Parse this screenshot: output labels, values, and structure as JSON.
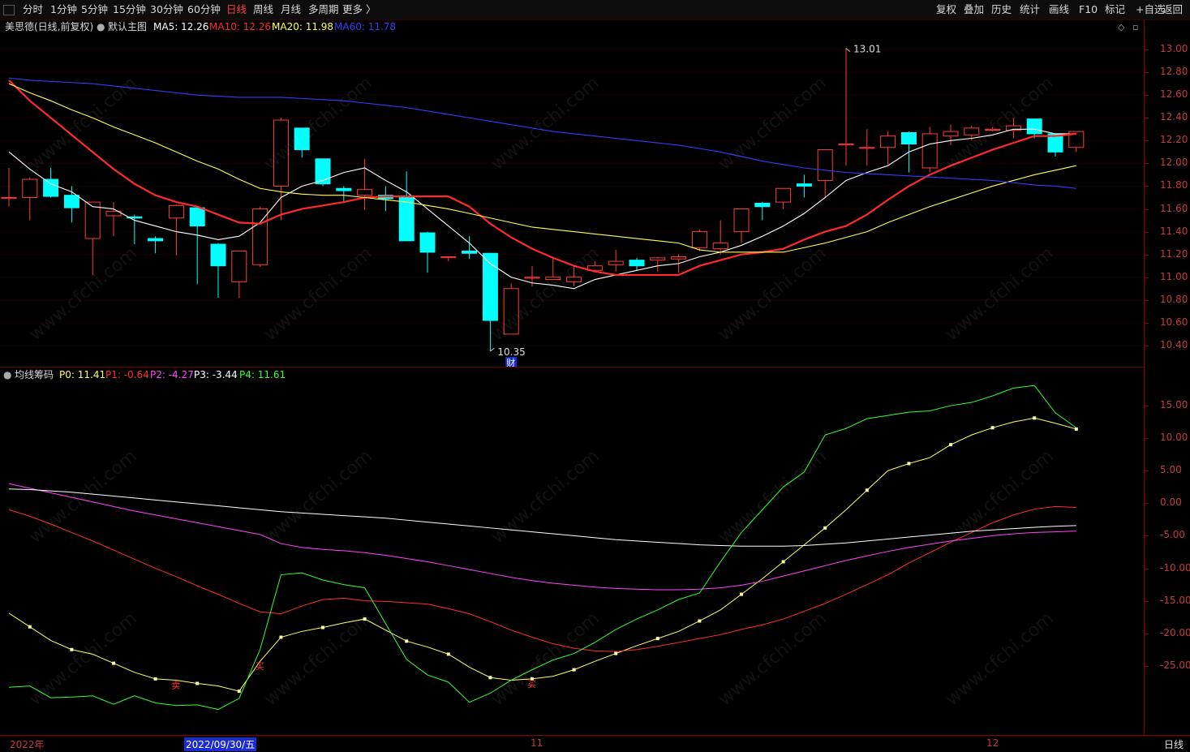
{
  "toolbar": {
    "left": [
      "分时",
      "1分钟",
      "5分钟",
      "15分钟",
      "30分钟",
      "60分钟",
      "日线",
      "周线",
      "月线",
      "多周期",
      "更多 〉"
    ],
    "active_index": 6,
    "right": [
      "复权",
      "叠加",
      "历史",
      "统计",
      "画线",
      "F10",
      "标记",
      "+自选",
      "返回"
    ]
  },
  "info": {
    "stock_title": "美思德(日线,前复权)",
    "main_chart": "默认主图",
    "ma": [
      {
        "label": "MA5: 12.26",
        "color": "#ffffff"
      },
      {
        "label": "MA10: 12.26",
        "color": "#ff2a2a"
      },
      {
        "label": "MA20: 11.98",
        "color": "#ffff55"
      },
      {
        "label": "MA60: 11.78",
        "color": "#3a3aff"
      }
    ]
  },
  "indicator": {
    "name": "均线筹码",
    "params": [
      {
        "label": "P0: 11.41",
        "color": "#ffff66"
      },
      {
        "label": "P1: -0.64",
        "color": "#ff3030"
      },
      {
        "label": "P2: -4.27",
        "color": "#ff44ff"
      },
      {
        "label": "P3: -3.44",
        "color": "#ffffff"
      },
      {
        "label": "P4: 11.61",
        "color": "#33ff33"
      }
    ]
  },
  "chart_data": [
    {
      "type": "candlestick",
      "ylim": [
        10.25,
        13.1
      ],
      "y_ticks": [
        "13.00",
        "12.80",
        "12.60",
        "12.40",
        "12.20",
        "12.00",
        "11.80",
        "11.60",
        "11.40",
        "11.20",
        "11.00",
        "10.80",
        "10.60",
        "10.40"
      ],
      "annotations": {
        "high_label": "13.01",
        "low_label": "10.35",
        "event_marker": "财"
      },
      "candles": [
        {
          "o": 11.7,
          "h": 11.96,
          "l": 11.62,
          "c": 11.7
        },
        {
          "o": 11.7,
          "h": 11.88,
          "l": 11.5,
          "c": 11.86
        },
        {
          "o": 11.86,
          "h": 11.96,
          "l": 11.7,
          "c": 11.71
        },
        {
          "o": 11.72,
          "h": 11.8,
          "l": 11.48,
          "c": 11.61
        },
        {
          "o": 11.34,
          "h": 11.66,
          "l": 11.02,
          "c": 11.66
        },
        {
          "o": 11.54,
          "h": 11.66,
          "l": 11.36,
          "c": 11.58
        },
        {
          "o": 11.53,
          "h": 11.55,
          "l": 11.29,
          "c": 11.52
        },
        {
          "o": 11.34,
          "h": 11.36,
          "l": 11.21,
          "c": 11.32
        },
        {
          "o": 11.52,
          "h": 11.64,
          "l": 11.19,
          "c": 11.63
        },
        {
          "o": 11.61,
          "h": 11.61,
          "l": 10.94,
          "c": 11.45
        },
        {
          "o": 11.29,
          "h": 11.3,
          "l": 10.82,
          "c": 11.1
        },
        {
          "o": 10.96,
          "h": 11.23,
          "l": 10.82,
          "c": 11.23
        },
        {
          "o": 11.11,
          "h": 11.62,
          "l": 11.09,
          "c": 11.6
        },
        {
          "o": 11.8,
          "h": 12.4,
          "l": 11.5,
          "c": 12.38
        },
        {
          "o": 12.31,
          "h": 12.31,
          "l": 12.05,
          "c": 12.12
        },
        {
          "o": 12.04,
          "h": 12.04,
          "l": 11.8,
          "c": 11.82
        },
        {
          "o": 11.78,
          "h": 11.8,
          "l": 11.65,
          "c": 11.76
        },
        {
          "o": 11.72,
          "h": 12.04,
          "l": 11.59,
          "c": 11.77
        },
        {
          "o": 11.72,
          "h": 11.8,
          "l": 11.58,
          "c": 11.69
        },
        {
          "o": 11.71,
          "h": 11.93,
          "l": 11.56,
          "c": 11.32
        },
        {
          "o": 11.39,
          "h": 11.4,
          "l": 11.04,
          "c": 11.22
        },
        {
          "o": 11.18,
          "h": 11.18,
          "l": 11.14,
          "c": 11.18
        },
        {
          "o": 11.23,
          "h": 11.36,
          "l": 11.16,
          "c": 11.21
        },
        {
          "o": 11.21,
          "h": 11.21,
          "l": 10.35,
          "c": 10.62
        },
        {
          "o": 10.5,
          "h": 10.95,
          "l": 10.5,
          "c": 10.9
        },
        {
          "o": 11.0,
          "h": 11.1,
          "l": 10.92,
          "c": 11.0
        },
        {
          "o": 10.98,
          "h": 11.18,
          "l": 10.98,
          "c": 11.0
        },
        {
          "o": 10.96,
          "h": 11.1,
          "l": 10.92,
          "c": 11.0
        },
        {
          "o": 11.06,
          "h": 11.14,
          "l": 11.05,
          "c": 11.1
        },
        {
          "o": 11.11,
          "h": 11.24,
          "l": 11.05,
          "c": 11.14
        },
        {
          "o": 11.15,
          "h": 11.17,
          "l": 11.06,
          "c": 11.1
        },
        {
          "o": 11.15,
          "h": 11.18,
          "l": 11.05,
          "c": 11.17
        },
        {
          "o": 11.16,
          "h": 11.2,
          "l": 11.04,
          "c": 11.18
        },
        {
          "o": 11.26,
          "h": 11.42,
          "l": 11.23,
          "c": 11.4
        },
        {
          "o": 11.25,
          "h": 11.5,
          "l": 11.2,
          "c": 11.3
        },
        {
          "o": 11.4,
          "h": 11.6,
          "l": 11.3,
          "c": 11.6
        },
        {
          "o": 11.65,
          "h": 11.66,
          "l": 11.5,
          "c": 11.62
        },
        {
          "o": 11.66,
          "h": 11.78,
          "l": 11.6,
          "c": 11.78
        },
        {
          "o": 11.82,
          "h": 11.9,
          "l": 11.7,
          "c": 11.8
        },
        {
          "o": 11.85,
          "h": 12.02,
          "l": 11.7,
          "c": 12.12
        },
        {
          "o": 12.17,
          "h": 13.01,
          "l": 11.98,
          "c": 12.17
        },
        {
          "o": 12.14,
          "h": 12.3,
          "l": 11.98,
          "c": 12.14
        },
        {
          "o": 12.14,
          "h": 12.28,
          "l": 11.99,
          "c": 12.24
        },
        {
          "o": 12.27,
          "h": 12.28,
          "l": 11.92,
          "c": 12.17
        },
        {
          "o": 11.96,
          "h": 12.32,
          "l": 11.92,
          "c": 12.26
        },
        {
          "o": 12.24,
          "h": 12.34,
          "l": 12.16,
          "c": 12.28
        },
        {
          "o": 12.25,
          "h": 12.33,
          "l": 12.2,
          "c": 12.31
        },
        {
          "o": 12.3,
          "h": 12.32,
          "l": 12.28,
          "c": 12.3
        },
        {
          "o": 12.29,
          "h": 12.4,
          "l": 12.22,
          "c": 12.33
        },
        {
          "o": 12.39,
          "h": 12.39,
          "l": 12.22,
          "c": 12.26
        },
        {
          "o": 12.26,
          "h": 12.26,
          "l": 12.06,
          "c": 12.1
        },
        {
          "o": 12.14,
          "h": 12.28,
          "l": 12.1,
          "c": 12.28
        }
      ],
      "series": [
        {
          "name": "MA5",
          "color": "#ffffff",
          "values": [
            12.1,
            11.95,
            11.82,
            11.75,
            11.62,
            11.6,
            11.5,
            11.45,
            11.4,
            11.37,
            11.33,
            11.36,
            11.48,
            11.7,
            11.8,
            11.85,
            11.92,
            11.96,
            11.85,
            11.75,
            11.6,
            11.45,
            11.3,
            11.12,
            11.0,
            10.95,
            10.93,
            10.9,
            10.98,
            11.02,
            11.06,
            11.1,
            11.12,
            11.18,
            11.22,
            11.28,
            11.36,
            11.45,
            11.56,
            11.7,
            11.85,
            11.92,
            11.98,
            12.1,
            12.17,
            12.2,
            12.22,
            12.25,
            12.3,
            12.3,
            12.26,
            12.26
          ]
        },
        {
          "name": "MA10",
          "color": "#ff2a2a",
          "values": [
            12.73,
            12.55,
            12.4,
            12.25,
            12.1,
            11.95,
            11.82,
            11.72,
            11.66,
            11.62,
            11.55,
            11.48,
            11.47,
            11.55,
            11.6,
            11.63,
            11.66,
            11.7,
            11.71,
            11.71,
            11.71,
            11.71,
            11.62,
            11.47,
            11.35,
            11.25,
            11.17,
            11.1,
            11.05,
            11.02,
            11.02,
            11.02,
            11.02,
            11.1,
            11.15,
            11.2,
            11.22,
            11.25,
            11.33,
            11.4,
            11.45,
            11.55,
            11.68,
            11.8,
            11.9,
            11.98,
            12.05,
            12.12,
            12.18,
            12.24,
            12.24,
            12.26
          ]
        },
        {
          "name": "MA20",
          "color": "#ffff55",
          "values": [
            12.7,
            12.62,
            12.55,
            12.47,
            12.4,
            12.32,
            12.25,
            12.18,
            12.1,
            12.02,
            11.95,
            11.86,
            11.78,
            11.75,
            11.73,
            11.72,
            11.72,
            11.7,
            11.68,
            11.66,
            11.63,
            11.6,
            11.56,
            11.52,
            11.48,
            11.44,
            11.42,
            11.4,
            11.38,
            11.36,
            11.34,
            11.32,
            11.3,
            11.24,
            11.22,
            11.22,
            11.22,
            11.22,
            11.26,
            11.3,
            11.35,
            11.4,
            11.48,
            11.55,
            11.62,
            11.68,
            11.74,
            11.8,
            11.85,
            11.9,
            11.94,
            11.98
          ]
        },
        {
          "name": "MA60",
          "color": "#3a3aff",
          "values": [
            12.75,
            12.73,
            12.72,
            12.71,
            12.7,
            12.68,
            12.66,
            12.64,
            12.62,
            12.6,
            12.59,
            12.58,
            12.58,
            12.58,
            12.57,
            12.56,
            12.55,
            12.53,
            12.51,
            12.49,
            12.46,
            12.43,
            12.4,
            12.37,
            12.34,
            12.31,
            12.28,
            12.26,
            12.24,
            12.22,
            12.2,
            12.18,
            12.16,
            12.13,
            12.1,
            12.06,
            12.02,
            11.99,
            11.96,
            11.94,
            11.92,
            11.91,
            11.9,
            11.89,
            11.88,
            11.87,
            11.86,
            11.85,
            11.83,
            11.81,
            11.8,
            11.78
          ]
        }
      ]
    },
    {
      "type": "line",
      "ylim": [
        -35,
        18
      ],
      "y_ticks": [
        "15.00",
        "10.00",
        "5.00",
        "0.00",
        "-5.00",
        "-10.00",
        "-15.00",
        "-20.00",
        "-25.00"
      ],
      "markers": [
        "卖",
        "买",
        "买"
      ],
      "series": [
        {
          "name": "P0",
          "color": "#ffff66",
          "values": [
            -16.9,
            -19.0,
            -21.1,
            -22.5,
            -23.2,
            -24.6,
            -26.0,
            -27.0,
            -27.2,
            -27.7,
            -28.1,
            -28.9,
            -24.3,
            -20.6,
            -19.7,
            -19.1,
            -18.4,
            -17.8,
            -19.5,
            -21.2,
            -22.1,
            -23.2,
            -25.2,
            -26.8,
            -27.2,
            -27.0,
            -26.6,
            -25.6,
            -24.3,
            -23.1,
            -21.9,
            -20.8,
            -19.7,
            -18.1,
            -16.4,
            -14.0,
            -11.6,
            -9.0,
            -6.4,
            -3.8,
            -1.0,
            2.0,
            5.0,
            6.1,
            7.0,
            9.0,
            10.5,
            11.6,
            12.5,
            13.1,
            12.3,
            11.4
          ]
        },
        {
          "name": "P1",
          "color": "#ff3030",
          "values": [
            -1.0,
            -2.0,
            -3.2,
            -4.5,
            -5.8,
            -7.2,
            -8.6,
            -10.0,
            -11.3,
            -12.7,
            -14.0,
            -15.4,
            -16.7,
            -17.0,
            -15.8,
            -14.8,
            -14.6,
            -15.0,
            -15.1,
            -15.3,
            -15.5,
            -16.2,
            -17.0,
            -18.2,
            -19.5,
            -20.6,
            -21.6,
            -22.3,
            -22.7,
            -22.8,
            -22.5,
            -22.0,
            -21.4,
            -20.8,
            -20.2,
            -19.4,
            -18.7,
            -17.8,
            -16.6,
            -15.4,
            -14.0,
            -12.5,
            -11.0,
            -9.2,
            -7.6,
            -6.0,
            -4.5,
            -3.0,
            -1.8,
            -0.9,
            -0.5,
            -0.64
          ]
        },
        {
          "name": "P2",
          "color": "#ff44ff",
          "values": [
            3.0,
            2.3,
            1.6,
            0.9,
            0.2,
            -0.5,
            -1.2,
            -1.8,
            -2.4,
            -3.0,
            -3.6,
            -4.2,
            -4.8,
            -6.2,
            -6.8,
            -7.1,
            -7.3,
            -7.6,
            -8.0,
            -8.5,
            -9.0,
            -9.6,
            -10.2,
            -10.8,
            -11.4,
            -11.9,
            -12.3,
            -12.6,
            -12.9,
            -13.1,
            -13.2,
            -13.3,
            -13.3,
            -13.2,
            -13.0,
            -12.6,
            -12.0,
            -11.2,
            -10.4,
            -9.6,
            -8.8,
            -8.1,
            -7.4,
            -6.8,
            -6.3,
            -5.8,
            -5.4,
            -5.0,
            -4.7,
            -4.5,
            -4.4,
            -4.27
          ]
        },
        {
          "name": "P3",
          "color": "#ffffff",
          "values": [
            2.2,
            2.1,
            1.9,
            1.7,
            1.4,
            1.1,
            0.8,
            0.5,
            0.2,
            -0.1,
            -0.4,
            -0.7,
            -1.0,
            -1.3,
            -1.5,
            -1.7,
            -1.9,
            -2.1,
            -2.3,
            -2.6,
            -2.9,
            -3.2,
            -3.5,
            -3.8,
            -4.1,
            -4.4,
            -4.7,
            -5.0,
            -5.3,
            -5.6,
            -5.8,
            -6.0,
            -6.2,
            -6.4,
            -6.5,
            -6.6,
            -6.6,
            -6.6,
            -6.5,
            -6.3,
            -6.1,
            -5.8,
            -5.5,
            -5.2,
            -4.9,
            -4.6,
            -4.3,
            -4.1,
            -3.9,
            -3.7,
            -3.55,
            -3.44
          ]
        },
        {
          "name": "P4",
          "color": "#33ff33",
          "values": [
            -28.3,
            -28.1,
            -29.9,
            -29.8,
            -29.6,
            -30.9,
            -29.6,
            -30.7,
            -31.1,
            -31.0,
            -31.7,
            -30.0,
            -22.5,
            -11.0,
            -10.7,
            -11.8,
            -12.5,
            -13.0,
            -18.5,
            -24.0,
            -26.4,
            -27.5,
            -30.6,
            -29.2,
            -27.2,
            -25.6,
            -24.1,
            -23.1,
            -21.4,
            -19.4,
            -17.8,
            -16.4,
            -14.8,
            -13.8,
            -9.0,
            -4.5,
            -1.0,
            2.5,
            4.8,
            10.5,
            11.5,
            13.0,
            13.5,
            14.0,
            14.2,
            15.0,
            15.5,
            16.5,
            17.7,
            18.1,
            13.9,
            11.61
          ]
        }
      ]
    }
  ],
  "date_labels": [
    "2022年",
    "2022/09/30/五",
    "11",
    "12"
  ],
  "period_button": "日线",
  "watermark": "www.cfchi.com"
}
